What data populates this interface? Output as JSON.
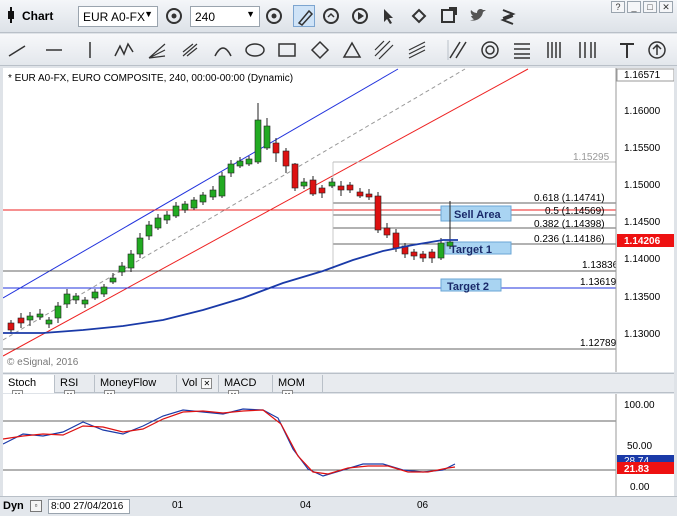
{
  "window": {
    "title": "Chart"
  },
  "toolbar": {
    "symbol": "EUR A0-FX",
    "interval": "240"
  },
  "chart": {
    "header": "* EUR A0-FX, EURO COMPOSITE, 240, 00:00-00:00 (Dynamic)",
    "watermark": "© eSignal, 2016",
    "price_axis": [
      "1.16571",
      "1.16000",
      "1.15500",
      "1.15000",
      "1.14500",
      "1.14000",
      "1.13500",
      "1.13000"
    ],
    "last_price": "1.14206",
    "fib_labels": {
      "top": "1.15295",
      "f618": "0.618 (1.14741)",
      "f50": "0.5 (1.14569)",
      "f382": "0.382 (1.14398)",
      "f236": "0.236 (1.14186)",
      "f0": "1.13836",
      "h1": "1.13619",
      "h2": "1.12789"
    },
    "zones": {
      "sell": "Sell Area",
      "t1": "Target 1",
      "t2": "Target 2"
    }
  },
  "tabs": [
    "Stoch",
    "RSI",
    "MoneyFlow",
    "Vol",
    "MACD",
    "MOM"
  ],
  "stoch": {
    "axis": [
      "100.00",
      "50.00",
      "0.00"
    ],
    "k_value": "28.74",
    "d_value": "21.83"
  },
  "bottombar": {
    "mode": "Dyn",
    "date": "8:00 27/04/2016",
    "x_labels": [
      "01",
      "04",
      "06"
    ]
  },
  "colors": {
    "up": "#22aa22",
    "down": "#dd1111",
    "ma": "#1a3aa8",
    "channel_blue": "#2233dd",
    "channel_red": "#ee2222",
    "zone": "#a9d4f2",
    "k": "#1a3aa8",
    "d": "#dd1111"
  }
}
